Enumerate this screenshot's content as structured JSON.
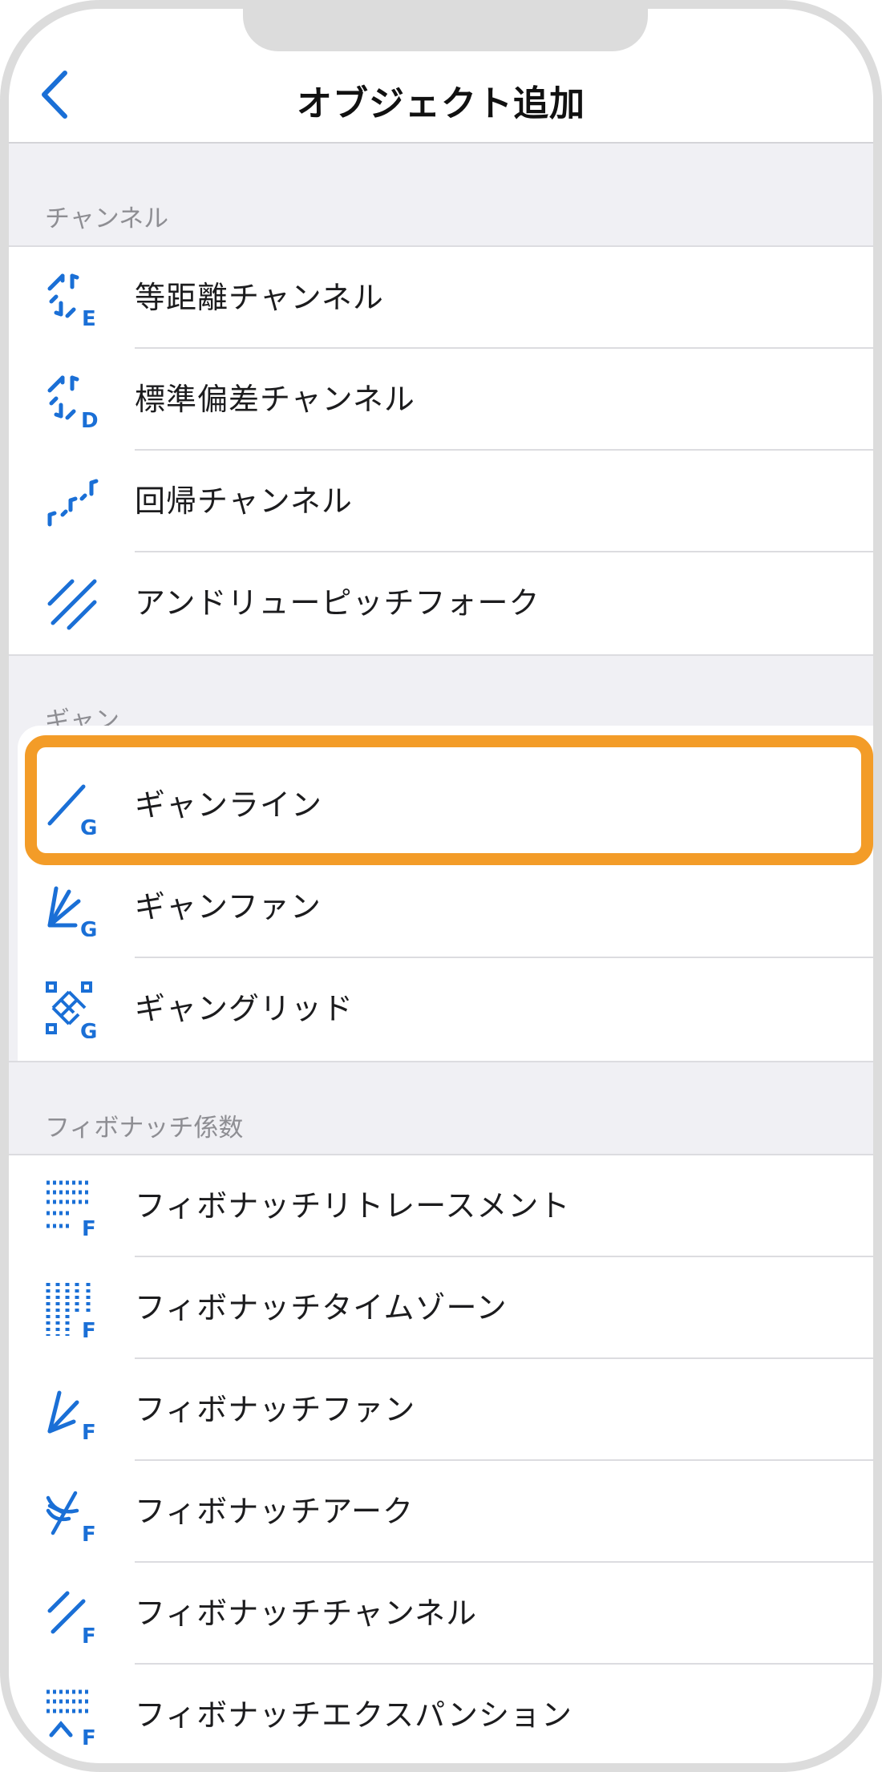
{
  "nav": {
    "title": "オブジェクト追加",
    "back_icon": "chevron-left-icon"
  },
  "colors": {
    "accent": "#1a6fd6",
    "highlight": "#f39c28",
    "section_text": "#8e8e93",
    "background": "#f0f0f4"
  },
  "sections": [
    {
      "header": "チャンネル",
      "items": [
        {
          "label": "等距離チャンネル",
          "icon": "equidistant-channel-icon"
        },
        {
          "label": "標準偏差チャンネル",
          "icon": "std-deviation-channel-icon"
        },
        {
          "label": "回帰チャンネル",
          "icon": "regression-channel-icon"
        },
        {
          "label": "アンドリューピッチフォーク",
          "icon": "andrews-pitchfork-icon"
        }
      ]
    },
    {
      "header": "ギャン",
      "items": [
        {
          "label": "ギャンライン",
          "icon": "gann-line-icon",
          "highlighted": true
        },
        {
          "label": "ギャンファン",
          "icon": "gann-fan-icon"
        },
        {
          "label": "ギャングリッド",
          "icon": "gann-grid-icon"
        }
      ]
    },
    {
      "header": "フィボナッチ係数",
      "items": [
        {
          "label": "フィボナッチリトレースメント",
          "icon": "fibonacci-retracement-icon"
        },
        {
          "label": "フィボナッチタイムゾーン",
          "icon": "fibonacci-timezones-icon"
        },
        {
          "label": "フィボナッチファン",
          "icon": "fibonacci-fan-icon"
        },
        {
          "label": "フィボナッチアーク",
          "icon": "fibonacci-arc-icon"
        },
        {
          "label": "フィボナッチチャンネル",
          "icon": "fibonacci-channel-icon"
        },
        {
          "label": "フィボナッチエクスパンション",
          "icon": "fibonacci-expansion-icon"
        }
      ]
    }
  ]
}
